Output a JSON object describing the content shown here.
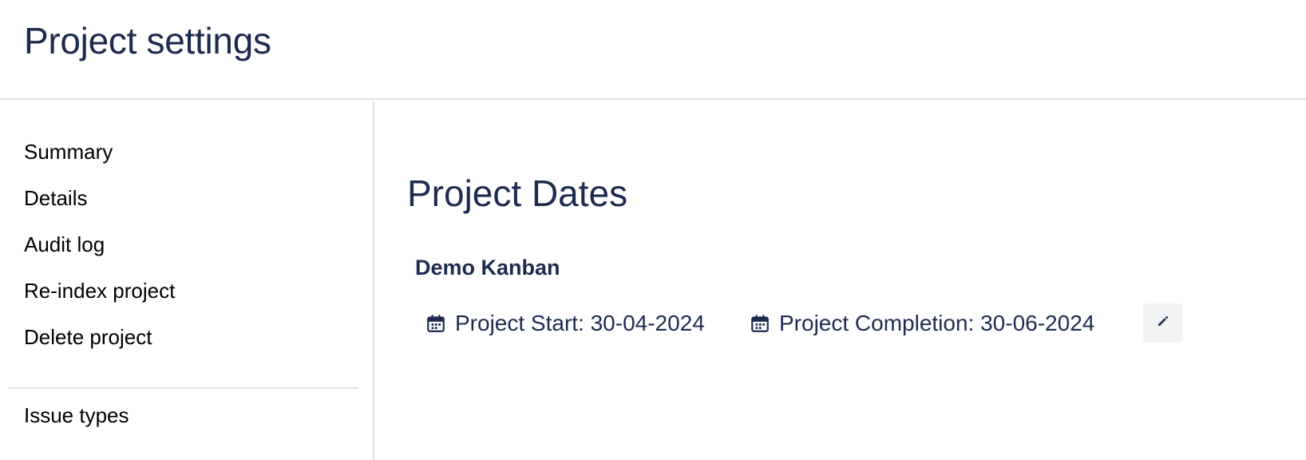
{
  "header": {
    "title": "Project settings"
  },
  "sidebar": {
    "items": [
      {
        "label": "Summary"
      },
      {
        "label": "Details"
      },
      {
        "label": "Audit log"
      },
      {
        "label": "Re-index project"
      },
      {
        "label": "Delete project"
      },
      {
        "label": "Issue types"
      }
    ]
  },
  "main": {
    "section_title": "Project Dates",
    "project_name": "Demo Kanban",
    "start": {
      "icon": "calendar-icon",
      "label": "Project Start: 30-04-2024"
    },
    "completion": {
      "icon": "calendar-icon",
      "label": "Project Completion: 30-06-2024"
    },
    "edit_icon": "pencil-icon"
  },
  "colors": {
    "text_primary": "#1d2b4f",
    "divider": "#dfe1e6",
    "button_bg": "#f1f2f4"
  }
}
